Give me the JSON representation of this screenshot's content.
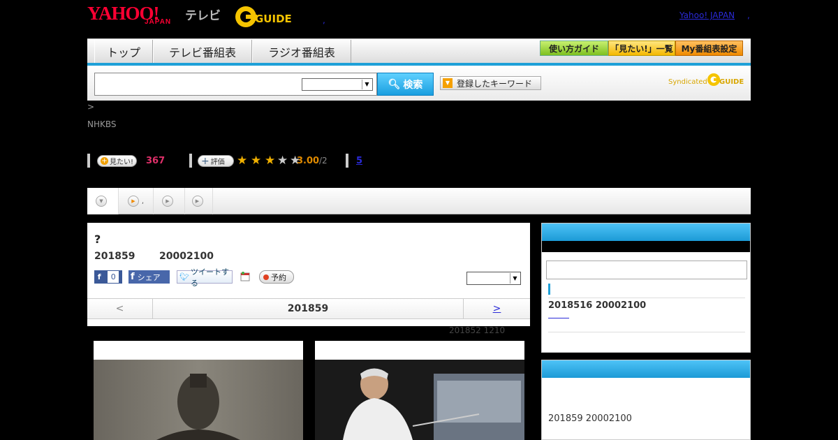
{
  "header": {
    "yahoo_logo": "YAHOO!",
    "yahoo_japan": "JAPAN",
    "tv_label": "テレビ",
    "gguide_logo": "G-GUIDE",
    "yahoo_japan_link": "Yahoo! JAPAN",
    "header_dot": ",",
    "yj_dot": ","
  },
  "nav": {
    "tabs": [
      "トップ",
      "テレビ番組表",
      "ラジオ番組表"
    ],
    "buttons": [
      "使い方ガイド",
      "「見たい!」一覧",
      "My番組表設定"
    ]
  },
  "search": {
    "input_value": "",
    "select_value": "",
    "search_button": "検索",
    "keyword_button": "登録したキーワード",
    "syndicated": "Syndicated"
  },
  "breadcrumb": ">",
  "channel": "NHKBS",
  "stats": {
    "want_label": "見たい!",
    "want_count": "367",
    "rate_label": "評価",
    "rating_value": "3.00",
    "rating_count": "/2",
    "rating_stars": 3,
    "link_text": "5"
  },
  "subtabs": [
    {
      "label": ""
    },
    {
      "label": ","
    },
    {
      "label": ""
    },
    {
      "label": ""
    }
  ],
  "program": {
    "title": "?",
    "date": "201859",
    "time": "20002100",
    "fb_like_count": "0",
    "fb_share": "シェア",
    "tweet": "ツイートする",
    "reserve": "予約",
    "select_value": ""
  },
  "datenav": {
    "prev": "<",
    "current": "201859",
    "next": ">"
  },
  "updated": "201852  1210",
  "side": {
    "item1": "2018516  20002100",
    "item2": "201859  20002100"
  },
  "colors": {
    "accent_blue": "#1ea0d8",
    "yahoo_red": "#ff0033",
    "gguide_yellow": "#f5c400",
    "want_count_color": "#e0306a",
    "rating_color": "#e08a00"
  }
}
